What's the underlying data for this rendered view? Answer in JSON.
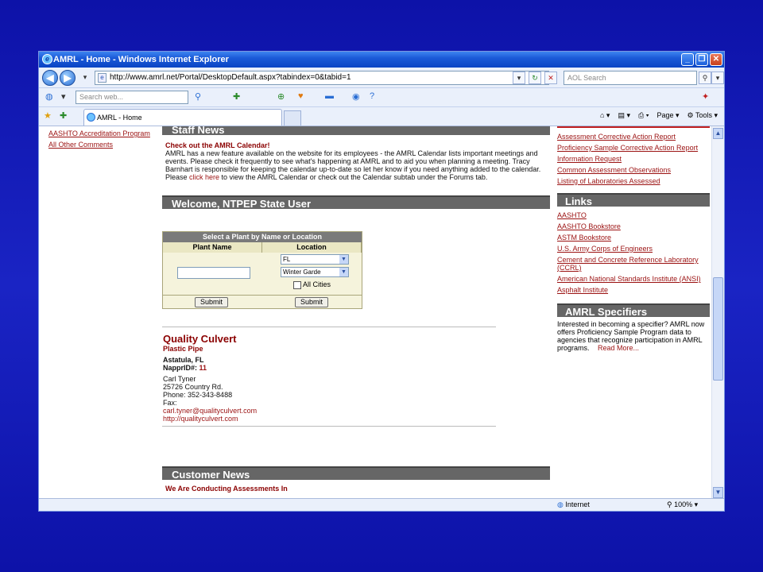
{
  "window": {
    "title": "AMRL - Home - Windows Internet Explorer"
  },
  "address": {
    "url": "http://www.amrl.net/Portal/DesktopDefault.aspx?tabindex=0&tabid=1",
    "search_placeholder": "AOL Search"
  },
  "toolbar": {
    "web_search_placeholder": "Search web..."
  },
  "tabs": [
    {
      "label": "AMRL - Home"
    }
  ],
  "commands": {
    "page": "Page",
    "tools": "Tools"
  },
  "left_links": [
    "AASHTO Accreditation Program",
    "All Other Comments"
  ],
  "staff_news": {
    "header": "Staff News",
    "title": "Check out the AMRL Calendar!",
    "body_before": "AMRL has a new feature available on the website for its employees - the AMRL Calendar lists important meetings and events. Please check it frequently to see what's happening at AMRL and to aid you when planning a meeting. Tracy Barnhart is responsible for keeping the calendar up-to-date so let her know if you need anything added to the calendar. Please ",
    "link": "click here",
    "body_after": " to view the AMRL Calendar or check out the Calendar subtab under the Forums tab."
  },
  "welcome": {
    "header": "Welcome, NTPEP State User"
  },
  "plant_search": {
    "title": "Select a Plant by Name or Location",
    "col_name": "Plant Name",
    "col_location": "Location",
    "state": "FL",
    "city": "Winter Garde",
    "all_cities": "All Cities",
    "submit": "Submit"
  },
  "listing": {
    "name": "Quality Culvert",
    "product": "Plastic Pipe",
    "location": "Astatula, FL",
    "nappr_label": "NapprID#:",
    "nappr_id": "11",
    "contact": "Carl  Tyner",
    "address": "25726 Country Rd.",
    "phone": "Phone: 352-343-8488",
    "fax": "Fax:",
    "email": "carl.tyner@qualityculvert.com",
    "website": "http://qualityculvert.com"
  },
  "customer_news": {
    "header": "Customer News",
    "first_item": "We Are Conducting Assessments In"
  },
  "right_top_links": [
    "Assessment Corrective Action Report",
    "Proficiency Sample Corrective Action Report",
    "Information Request",
    "Common Assessment Observations",
    "Listing of Laboratories Assessed"
  ],
  "links_section": {
    "header": "Links",
    "items": [
      "AASHTO",
      "AASHTO Bookstore",
      "ASTM Bookstore",
      "U.S. Army Corps of Engineers",
      "Cement and Concrete Reference Laboratory (CCRL)",
      "American National Standards Institute (ANSI)",
      "Asphalt Institute"
    ]
  },
  "specifiers": {
    "header": "AMRL Specifiers",
    "body": "Interested in becoming a specifier? AMRL now offers Proficiency Sample Program data to agencies that recognize participation in AMRL programs.",
    "more": "Read More..."
  },
  "status": {
    "zone": "Internet",
    "zoom": "100%"
  }
}
